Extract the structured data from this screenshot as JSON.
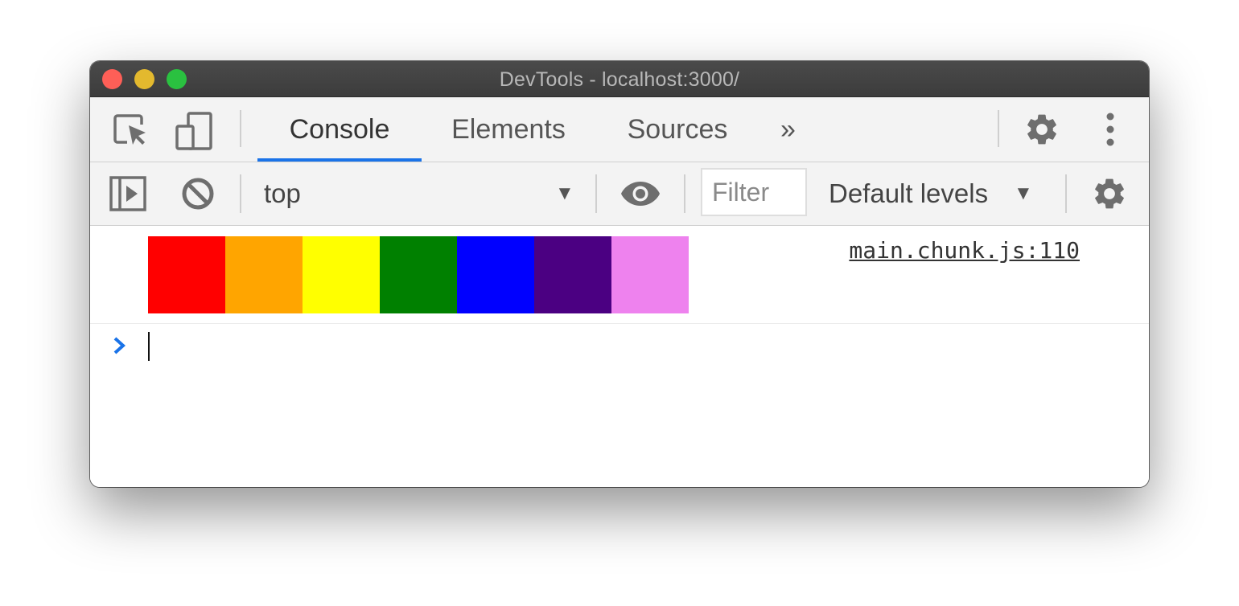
{
  "window": {
    "title": "DevTools - localhost:3000/"
  },
  "toolbar": {
    "tabs": [
      {
        "label": "Console",
        "active": true
      },
      {
        "label": "Elements",
        "active": false
      },
      {
        "label": "Sources",
        "active": false
      }
    ],
    "more_label": "»",
    "icons": [
      "inspect-element-icon",
      "device-toggle-icon",
      "settings-gear-icon",
      "more-vertical-icon"
    ]
  },
  "console_toolbar": {
    "context": "top",
    "filter_placeholder": "Filter",
    "levels_label": "Default levels",
    "icons": [
      "sidebar-toggle-icon",
      "clear-console-icon",
      "live-expression-eye-icon",
      "console-settings-gear-icon"
    ]
  },
  "console": {
    "source_link": "main.chunk.js:110",
    "swatches": [
      "#ff0000",
      "#ffa500",
      "#ffff00",
      "#008000",
      "#0000ff",
      "#4b0082",
      "#ee82ee"
    ],
    "prompt_symbol": "›"
  },
  "colors": {
    "accent": "#1a73e8",
    "icon": "#6e6e6e"
  }
}
